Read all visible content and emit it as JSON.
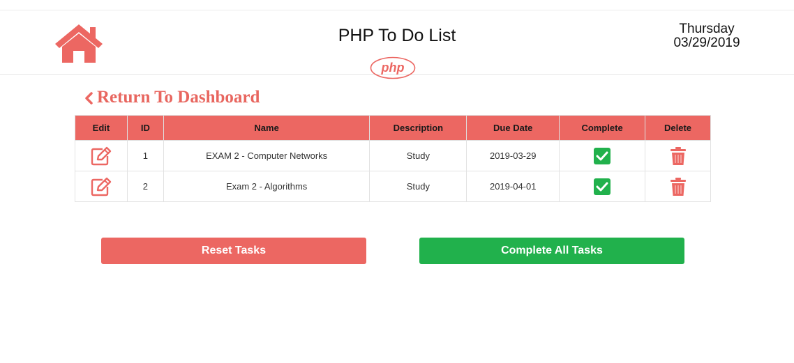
{
  "header": {
    "title": "PHP To Do List",
    "day": "Thursday",
    "date": "03/29/2019",
    "logo_text": "php"
  },
  "nav": {
    "back_label": "Return To Dashboard"
  },
  "table": {
    "columns": [
      "Edit",
      "ID",
      "Name",
      "Description",
      "Due Date",
      "Complete",
      "Delete"
    ],
    "rows": [
      {
        "id": "1",
        "name": "EXAM 2 - Computer Networks",
        "description": "Study",
        "due_date": "2019-03-29",
        "complete": true
      },
      {
        "id": "2",
        "name": "Exam 2 - Algorithms",
        "description": "Study",
        "due_date": "2019-04-01",
        "complete": true
      }
    ]
  },
  "actions": {
    "reset_label": "Reset Tasks",
    "complete_all_label": "Complete All Tasks"
  },
  "icons": {
    "home": "home-icon",
    "edit": "edit-icon",
    "check": "checkbox-checked-icon",
    "delete": "trash-icon",
    "back": "chevron-left-icon"
  },
  "colors": {
    "accent": "#ec6762",
    "success": "#21b14c"
  }
}
